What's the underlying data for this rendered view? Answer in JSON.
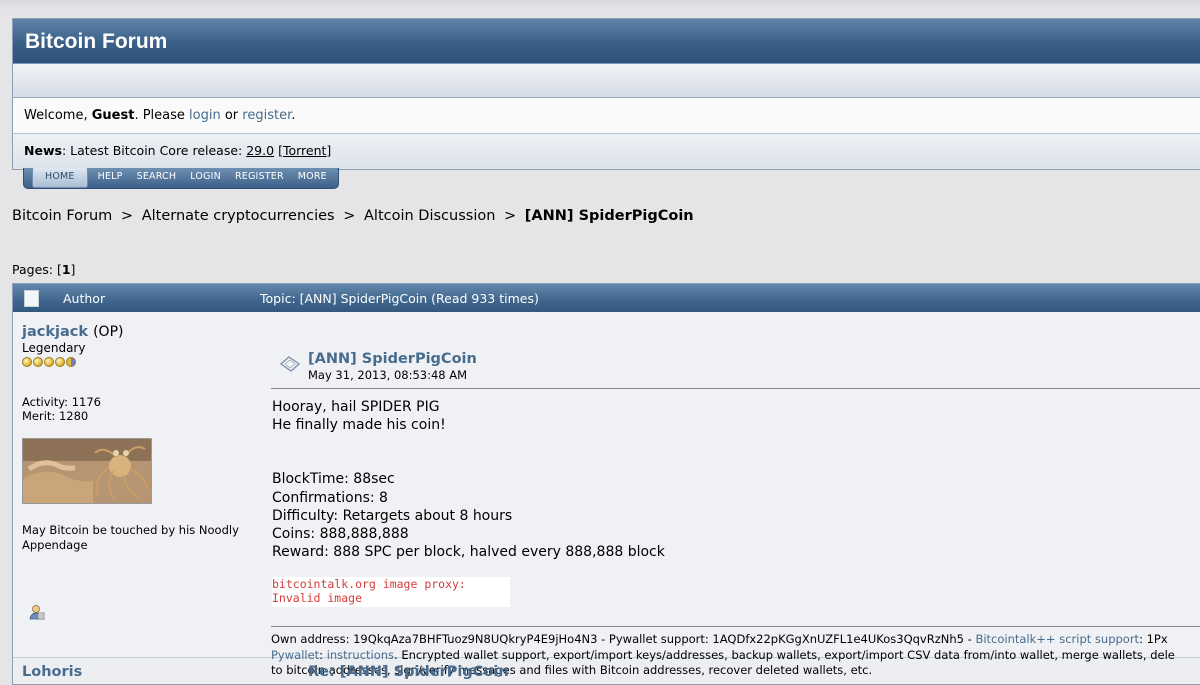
{
  "header": {
    "title": "Bitcoin Forum"
  },
  "welcome": {
    "prefix": "Welcome, ",
    "user": "Guest",
    "mid": ". Please ",
    "login": "login",
    "or": " or ",
    "register": "register",
    "end": "."
  },
  "news": {
    "label": "News",
    "text": ": Latest Bitcoin Core release: ",
    "version": "29.0",
    "torrent": "[Torrent]"
  },
  "menu": [
    "HOME",
    "HELP",
    "SEARCH",
    "LOGIN",
    "REGISTER",
    "MORE"
  ],
  "breadcrumb": {
    "items": [
      "Bitcoin Forum",
      "Alternate cryptocurrencies",
      "Altcoin Discussion"
    ],
    "current": "[ANN] SpiderPigCoin",
    "separator": ">"
  },
  "pages": {
    "label": "Pages: [",
    "current": "1",
    "end": "]"
  },
  "topic_header": {
    "author": "Author",
    "topic": "Topic: [ANN] SpiderPigCoin  (Read 933 times)"
  },
  "post": {
    "author": "jackjack",
    "op": "(OP)",
    "rank": "Legendary",
    "activity": "Activity: 1176",
    "merit": "Merit: 1280",
    "personal_text": "May Bitcoin be touched by his Noodly Appendage",
    "title": "[ANN] SpiderPigCoin",
    "date": "May 31, 2013, 08:53:48 AM",
    "lines": [
      "Hooray, hail SPIDER PIG",
      "He finally made his coin!",
      "",
      "",
      "BlockTime: 88sec",
      "Confirmations: 8",
      "Difficulty: Retargets about 8 hours",
      "Coins: 888,888,888",
      "Reward: 888 SPC per block, halved every 888,888 block"
    ],
    "proxy_line1": "bitcointalk.org image proxy:",
    "proxy_line2": "Invalid image",
    "signature": {
      "own_address": "Own address: 19QkqAza7BHFTuoz9N8UQkryP4E9jHo4N3 - Pywallet support: 1AQDfx22pKGgXnUZFL1e4UKos3QqvRzNh5 - ",
      "link1": "Bitcointalk++ script support",
      "after_link1": ": 1Px",
      "link2": "Pywallet",
      "colon": ": ",
      "link3": "instructions",
      "rest": ". Encrypted wallet support, export/import keys/addresses, backup wallets, export/import CSV data from/into wallet, merge wallets, dele",
      "line3": "to bitcoin addresses, sign/verify messages and files with Bitcoin addresses, recover deleted wallets, etc."
    }
  },
  "next_post": {
    "author": "Lohoris",
    "title": "Re: [ANN] SpiderPigCoin"
  },
  "colors": {
    "header_blue": "#3a6087",
    "link": "#476c8e",
    "proxy_red": "#d63b3b"
  }
}
